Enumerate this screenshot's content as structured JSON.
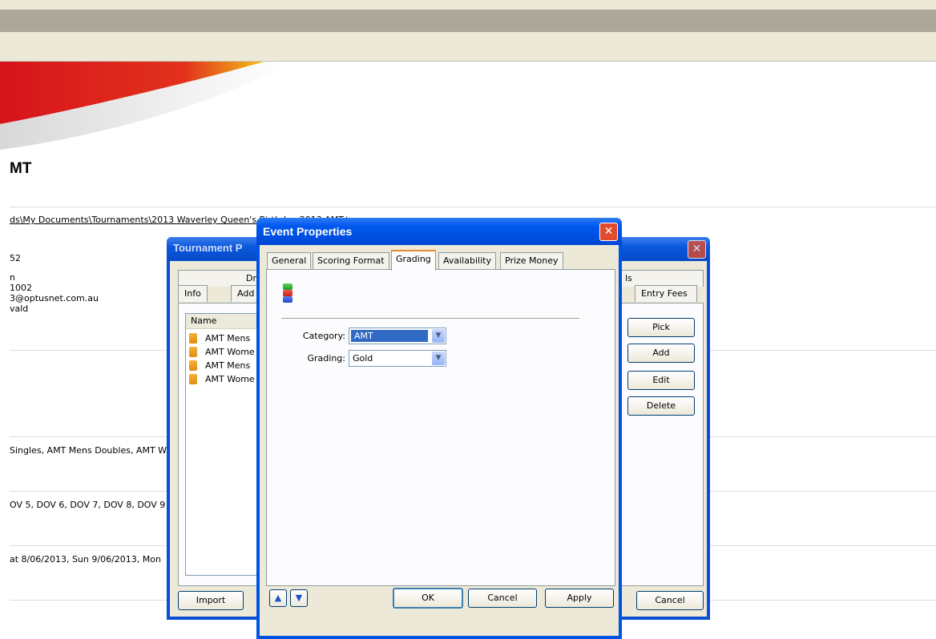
{
  "background": {
    "title": "MT",
    "path": "ds\\My Documents\\Tournaments\\2013 Waverley Queen's Birthday 2013 AMT.t",
    "lines": [
      "52",
      "n",
      " 1002",
      "3@optusnet.com.au",
      "vald"
    ],
    "events_line": " Singles, AMT Mens Doubles, AMT W",
    "divisions_line": "OV 5, DOV 6, DOV 7, DOV 8, DOV 9",
    "dates_line": "at 8/06/2013, Sun 9/06/2013, Mon"
  },
  "tournament_window": {
    "title": "Tournament P",
    "top_tabs": [
      "Dr",
      "ls"
    ],
    "tabs": [
      "Info",
      "Add",
      "Entry Fees"
    ],
    "list_header": "Name",
    "list_items": [
      "AMT Mens",
      "AMT Wome",
      "AMT Mens",
      "AMT Wome"
    ],
    "buttons": {
      "pick": "Pick",
      "add": "Add",
      "edit": "Edit",
      "delete": "Delete",
      "import": "Import",
      "cancel": "Cancel"
    }
  },
  "event_dialog": {
    "title": "Event Properties",
    "tabs": [
      "General",
      "Scoring Format",
      "Grading",
      "Availability",
      "Prize Money"
    ],
    "active_tab": "Grading",
    "category_label": "Category:",
    "category_value": "AMT",
    "grading_label": "Grading:",
    "grading_value": "Gold",
    "buttons": {
      "ok": "OK",
      "cancel": "Cancel",
      "apply": "Apply"
    }
  }
}
